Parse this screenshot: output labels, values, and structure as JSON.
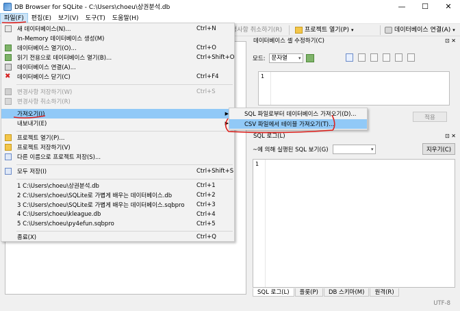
{
  "window": {
    "title": "DB Browser for SQLite - C:\\Users\\choeu\\상권분석.db",
    "minimize": "—",
    "maximize": "☐",
    "close": "✕"
  },
  "menubar": [
    {
      "label": "파일(F)"
    },
    {
      "label": "편집(E)"
    },
    {
      "label": "보기(V)"
    },
    {
      "label": "도구(T)"
    },
    {
      "label": "도움말(H)"
    }
  ],
  "toolbar": {
    "undo": "경사항 취소하기(R)",
    "open_project": "프로젝트 열기(P)",
    "attach_db": "데이터베이스 연결(A)"
  },
  "file_menu": {
    "new_db": {
      "label": "새 데이터베이스(N)...",
      "shortcut": "Ctrl+N"
    },
    "in_memory": {
      "label": "In-Memory 데이터베이스 생성(M)"
    },
    "open_db": {
      "label": "데이터베이스 열기(O)...",
      "shortcut": "Ctrl+O"
    },
    "open_readonly": {
      "label": "읽기 전용으로 데이터베이스 열기(B)...",
      "shortcut": "Ctrl+Shift+O"
    },
    "attach": {
      "label": "데이터베이스 연결(A)..."
    },
    "close_db": {
      "label": "데이터베이스 닫기(C)",
      "shortcut": "Ctrl+F4"
    },
    "write_changes": {
      "label": "변경사항 저장하기(W)",
      "shortcut": "Ctrl+S"
    },
    "revert_changes": {
      "label": "변경사항 취소하기(R)"
    },
    "import": {
      "label": "가져오기(I)"
    },
    "export": {
      "label": "내보내기(E)"
    },
    "open_project": {
      "label": "프로젝트 열기(P)..."
    },
    "save_project": {
      "label": "프로젝트 저장하기(V)"
    },
    "save_project_as": {
      "label": "다른 이름으로 프로젝트 저장(S)..."
    },
    "save_all": {
      "label": "모두 저장(I)",
      "shortcut": "Ctrl+Shift+S"
    },
    "recent": [
      {
        "label": "1 C:\\Users\\choeu\\상권분석.db",
        "shortcut": "Ctrl+1"
      },
      {
        "label": "2 C:\\Users\\choeu\\SQLite로 가볍게 배우는 데이터베이스.db",
        "shortcut": "Ctrl+2"
      },
      {
        "label": "3 C:\\Users\\choeu\\SQLite로 가볍게 배우는 데이터베이스.sqbpro",
        "shortcut": "Ctrl+3"
      },
      {
        "label": "4 C:\\Users\\choeu\\kleague.db",
        "shortcut": "Ctrl+4"
      },
      {
        "label": "5 C:\\Users\\choeu\\py4efun.sqbpro",
        "shortcut": "Ctrl+5"
      }
    ],
    "exit": {
      "label": "종료(X)",
      "shortcut": "Ctrl+Q"
    }
  },
  "import_submenu": {
    "from_sql": "SQL 파일로부터 데이터베이스 가져오기(D)...",
    "from_csv": "CSV 파일에서 테이블 가져오기(T)..."
  },
  "edit_cell_dock": {
    "title": "데이터베이스 셀 수정하기(C)",
    "mode_label": "모드:",
    "mode_value": "문자열",
    "line_no": "1",
    "apply": "적용"
  },
  "sql_log_dock": {
    "title": "SQL 로그(L)",
    "filter_label": "~에 의해 실행된 SQL 보기(G)",
    "clear": "지우기(C)",
    "line_no": "1"
  },
  "bottom_tabs": [
    {
      "label": "SQL 로그(L)"
    },
    {
      "label": "플롯(P)"
    },
    {
      "label": "DB 스키마(M)"
    },
    {
      "label": "원격(R)"
    }
  ],
  "status": {
    "encoding": "UTF-8"
  },
  "dock_controls": "⊡ ✕",
  "colors": {
    "highlight": "#91c9f7",
    "annotation": "#e0201c"
  }
}
